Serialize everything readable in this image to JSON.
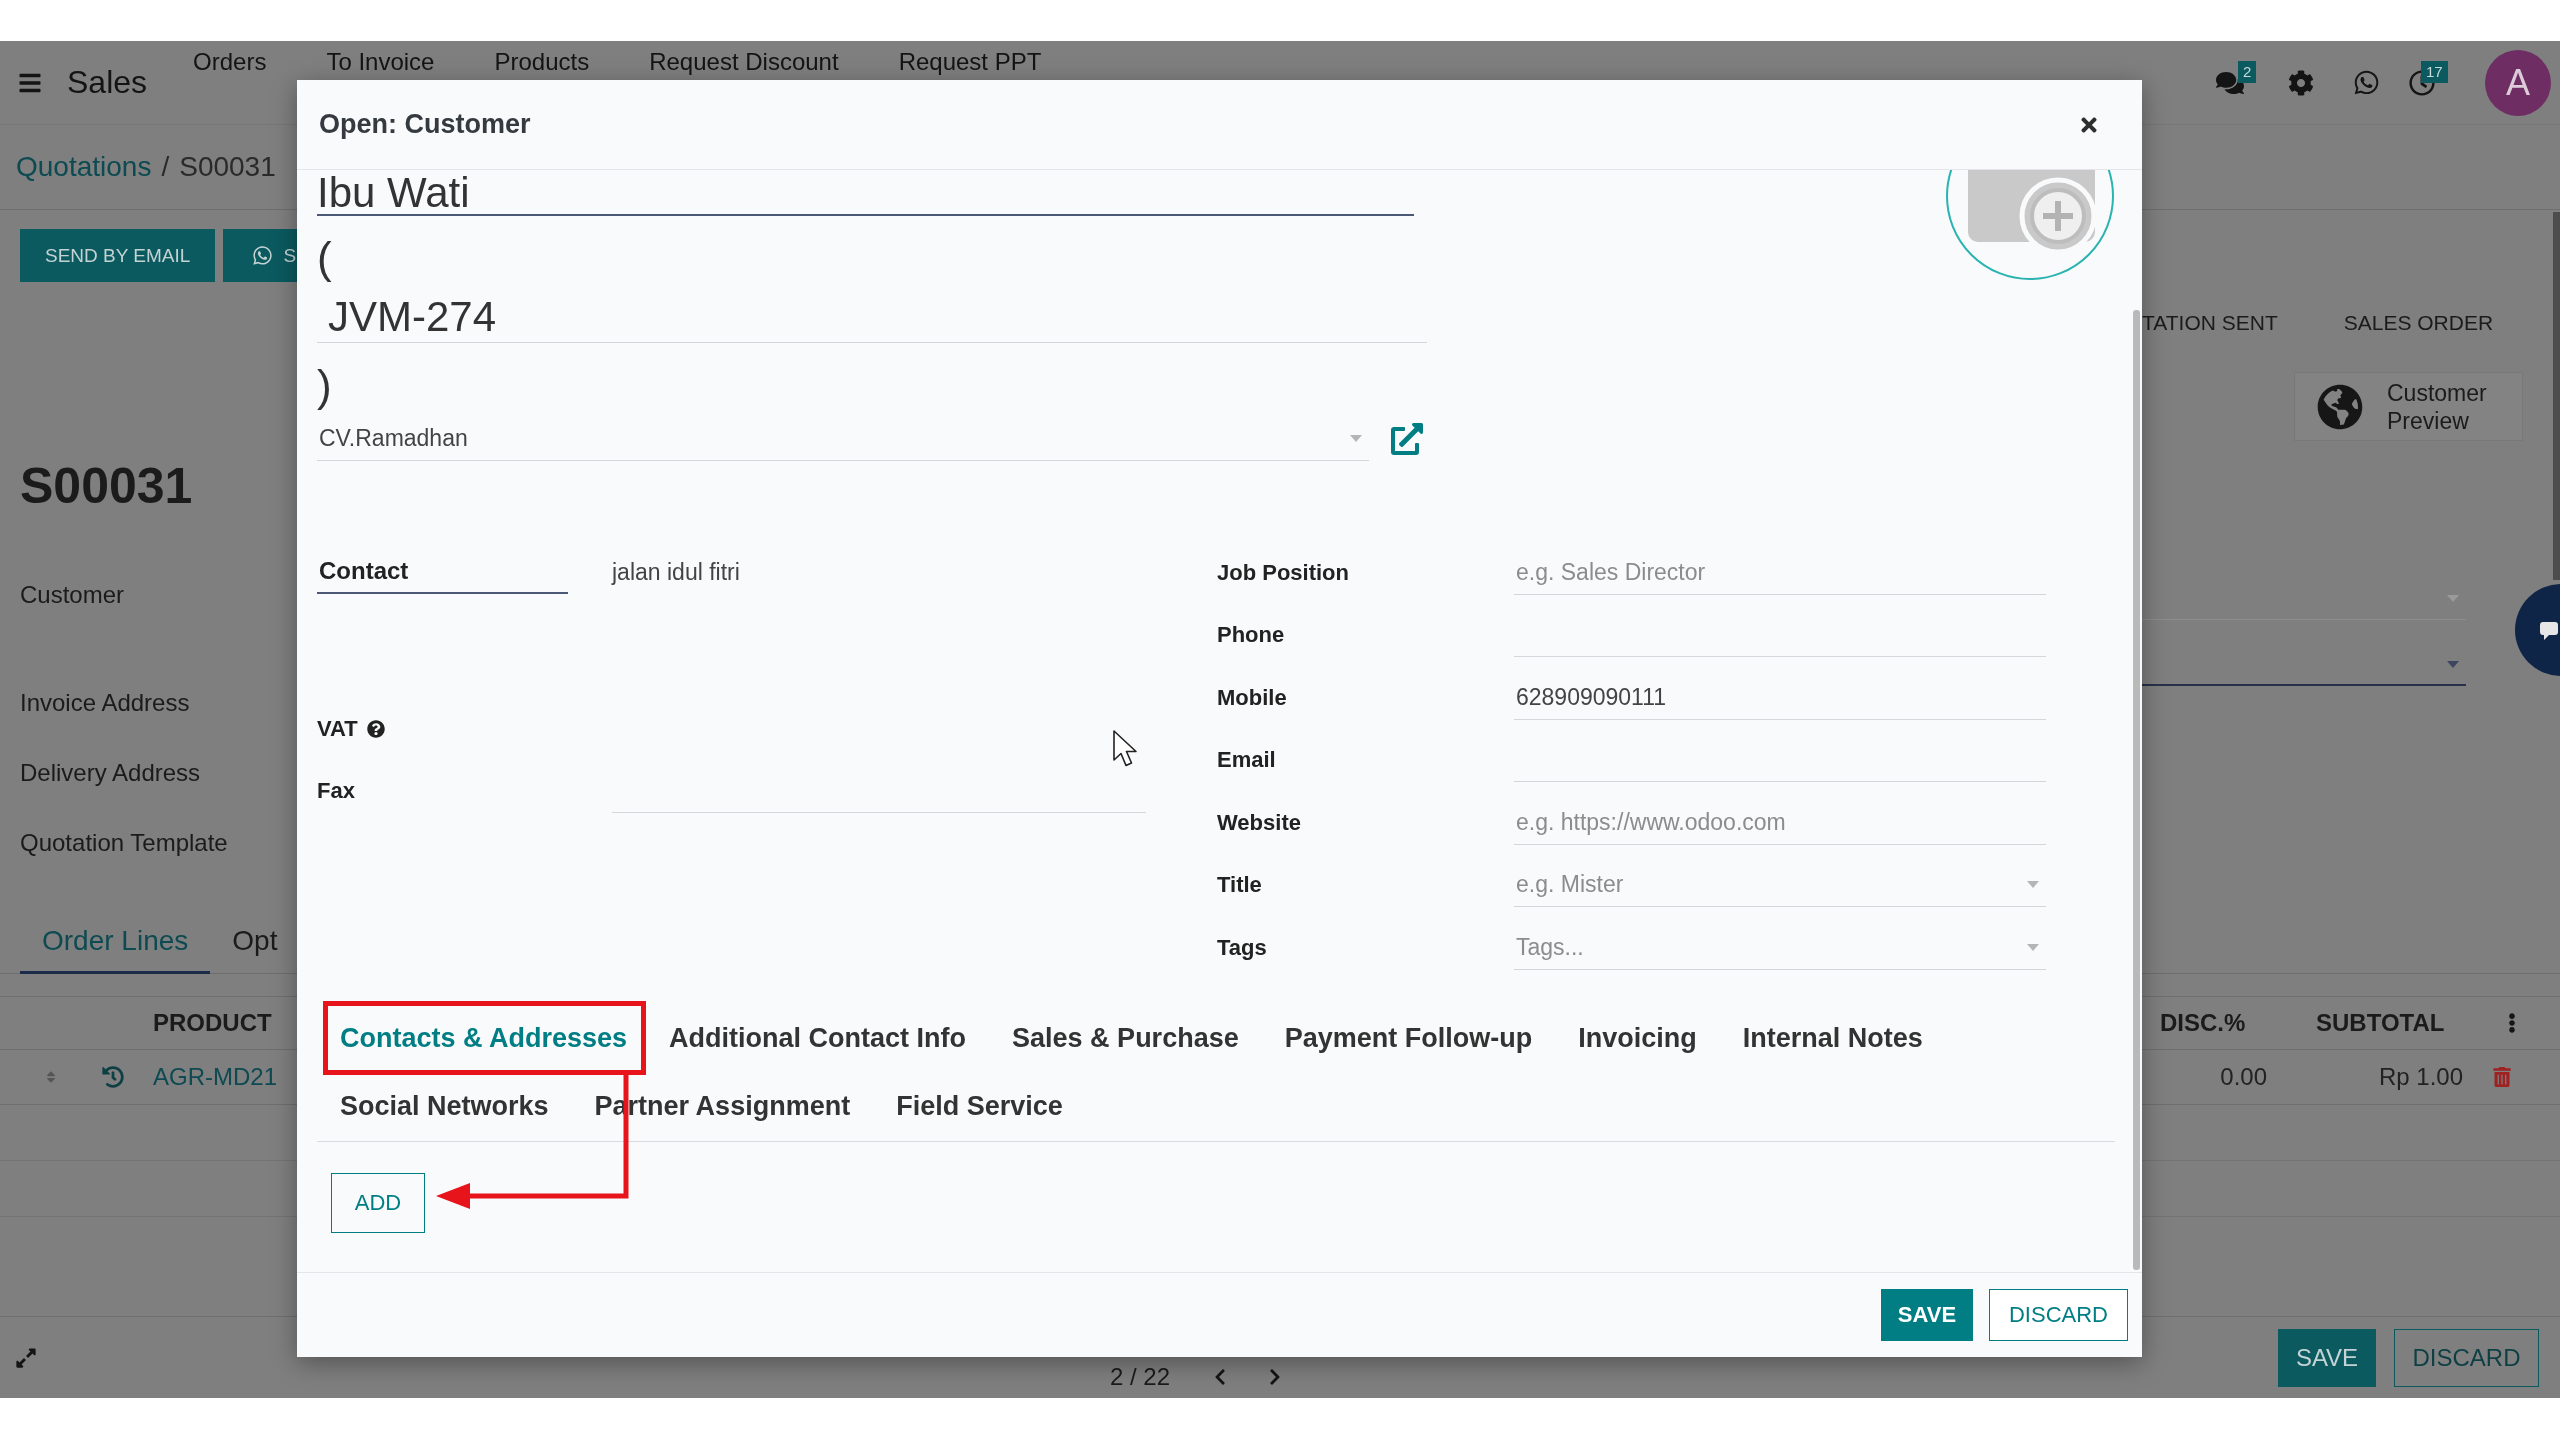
{
  "navbar": {
    "app": "Sales",
    "menu": [
      "Orders",
      "To Invoice",
      "Products",
      "Request Discount",
      "Request PPT"
    ],
    "message_count": "2",
    "activity_count": "17",
    "avatar": "A"
  },
  "breadcrumb": {
    "items": [
      "Quotations",
      "S00031"
    ],
    "separator": "/"
  },
  "action_buttons": [
    {
      "label": "SEND BY EMAIL",
      "kind": "plain"
    },
    {
      "label": "S",
      "kind": "icon"
    }
  ],
  "status_bar": [
    {
      "label": "TATION SENT",
      "selected": false
    },
    {
      "label": "SALES ORDER",
      "selected": false
    }
  ],
  "smart_button": {
    "label": "Customer Preview"
  },
  "record": {
    "name": "S00031",
    "fields": [
      "Customer",
      "Invoice Address",
      "Delivery Address",
      "Quotation Template"
    ]
  },
  "side_selects": [
    {
      "focused": false
    },
    {
      "focused": true
    }
  ],
  "tabs": [
    {
      "label": "Order Lines",
      "selected": true
    },
    {
      "label": "Opt",
      "selected": false
    }
  ],
  "order_lines": {
    "columns": [
      "PRODUCT",
      "DISC.%",
      "SUBTOTAL"
    ],
    "rows": [
      {
        "product": "AGR-MD21",
        "discount": "0.00",
        "subtotal": "Rp 1.00"
      }
    ]
  },
  "pager": "2 / 22",
  "form_buttons": [
    "SAVE",
    "DISCARD"
  ],
  "dialog": {
    "title": "Open: Customer",
    "name": "Ibu Wati",
    "open_paren": "(",
    "reference": "JVM-274",
    "close_paren": ")",
    "company": "CV.Ramadhan",
    "address_type": "Contact",
    "street": "jalan idul fitri",
    "left_fields": [
      {
        "label": "VAT",
        "kind": "readonly",
        "help": true
      },
      {
        "label": "Fax",
        "kind": "text",
        "help": false
      }
    ],
    "right_fields": [
      {
        "label": "Job Position",
        "kind": "text",
        "placeholder": "e.g. Sales Director"
      },
      {
        "label": "Phone",
        "kind": "text"
      },
      {
        "label": "Mobile",
        "kind": "text",
        "value": "628909090111"
      },
      {
        "label": "Email",
        "kind": "text"
      },
      {
        "label": "Website",
        "kind": "text",
        "placeholder": "e.g. https://www.odoo.com"
      },
      {
        "label": "Title",
        "kind": "select",
        "placeholder": "e.g. Mister"
      },
      {
        "label": "Tags",
        "kind": "select",
        "placeholder": "Tags..."
      }
    ],
    "tabs": [
      {
        "label": "Contacts & Addresses",
        "selected": true,
        "highlighted": true
      },
      {
        "label": "Additional Contact Info",
        "selected": false,
        "highlighted": false
      },
      {
        "label": "Sales & Purchase",
        "selected": false,
        "highlighted": false
      },
      {
        "label": "Payment Follow-up",
        "selected": false,
        "highlighted": false
      },
      {
        "label": "Invoicing",
        "selected": false,
        "highlighted": false
      },
      {
        "label": "Internal Notes",
        "selected": false,
        "highlighted": false
      },
      {
        "label": "Social Networks",
        "selected": false,
        "highlighted": false
      },
      {
        "label": "Partner Assignment",
        "selected": false,
        "highlighted": false
      },
      {
        "label": "Field Service",
        "selected": false,
        "highlighted": false
      }
    ],
    "add_button": "ADD",
    "buttons": [
      "SAVE",
      "DISCARD"
    ]
  }
}
